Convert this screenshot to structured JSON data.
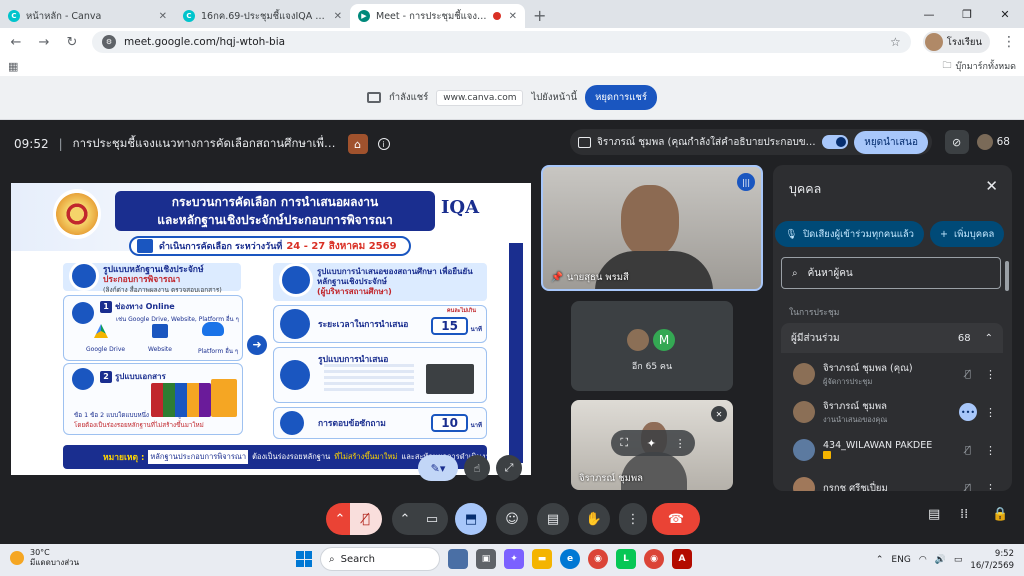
{
  "browser": {
    "tabs": [
      {
        "title": "หน้าหลัก - Canva",
        "active": false,
        "favicon_color": "#00c4cc"
      },
      {
        "title": "16กค.69-ประชุมชี้แจงIQA - พร...",
        "active": false,
        "favicon_color": "#00c4cc"
      },
      {
        "title": "Meet - การประชุมชี้แจงแนวทา...",
        "active": true,
        "favicon_color": "#00897b"
      }
    ],
    "url": "meet.google.com/hqj-wtoh-bia",
    "profile_name": "โรงเรียน",
    "all_bookmarks": "บุ๊กมาร์กทั้งหมด"
  },
  "share_bar": {
    "sharing_label": "กำลังแชร์",
    "shared_site": "www.canva.com",
    "to_label": "ไปยังหน้านี้",
    "stop_label": "หยุดการแชร์"
  },
  "meet": {
    "time": "09:52",
    "meeting_title": "การประชุมชี้แจงแนวทางการคัดเลือกสถานศึกษาเพื่อรับรางวัล...",
    "presenter_text": "จิราภรณ์ ชุมพล (คุณกำลังใส่คำอธิบายประกอบขณะนำเสนอ)",
    "stop_presenting": "หยุดนำเสนอ",
    "participant_count": "68"
  },
  "slide": {
    "title_line1": "กระบวนการคัดเลือก การนำเสนอผลงาน",
    "title_line2": "และหลักฐานเชิงประจักษ์ประกอบการพิจารณา",
    "iqa": "IQA",
    "date_prefix": "ดำเนินการคัดเลือก ระหว่างวันที่",
    "date_range": "24 - 27 สิงหาคม 2569",
    "left_header_1": "รูปแบบหลักฐานเชิงประจักษ์",
    "left_header_2": "ประกอบการพิจารณา",
    "left_header_3": "(ลิงก์ต่าง สื่อภาพผลงาน ตรวจสอบเอกสาร)",
    "item1_title": "ช่องทาง Online",
    "item1_sub": "เช่น Google Drive, Website, Platform อื่น ๆ",
    "item1_icons": [
      "Google Drive",
      "Website",
      "Platform อื่น ๆ"
    ],
    "item2_title": "รูปแบบเอกสาร",
    "item2_note": "ข้อ 1 ข้อ 2 แบบใดแบบหนึ่ง หรือทั้ง 2 รูปแบบ",
    "item2_note2": "โดยต้องเป็นร่องรอยหลักฐานที่ไม่สร้างขึ้นมาใหม่",
    "right_header_1": "รูปแบบการนำเสนอของสถานศึกษา",
    "right_header_2": "เพื่อยืนยันหลักฐานเชิงประจักษ์",
    "right_header_3": "(ผู้บริหารสถานศึกษา)",
    "row1_label": "ระยะเวลาในการนำเสนอ",
    "row1_value": "15",
    "row1_prefix": "คนละไม่เกิน",
    "row1_unit": "นาที",
    "row2_label": "รูปแบบการนำเสนอ",
    "row3_label": "การตอบข้อซักถาม",
    "row3_value": "10",
    "row3_unit": "นาที",
    "note_label": "หมายเหตุ :",
    "note_highlight": "หลักฐานประกอบการพิจารณา",
    "note_text_1": "ต้องเป็นร่องรอยหลักฐาน",
    "note_text_2": "ที่ไม่สร้างขึ้นมาใหม่",
    "note_text_3": "และสะท้อนผลการดำเนินงานจริงของสถานศึกษา"
  },
  "tiles": {
    "speaker_name": "นายสุธน พรมสี",
    "others_count": "อีก 65 คน",
    "others_avatar_letter": "M",
    "self_name": "จิราภรณ์ ชุมพล"
  },
  "people_panel": {
    "title": "บุคคล",
    "mute_all": "ปิดเสียงผู้เข้าร่วมทุกคนแล้ว",
    "add_people": "เพิ่มบุคคล",
    "search_placeholder": "ค้นหาผู้คน",
    "section": "ในการประชุม",
    "group_label": "ผู้มีส่วนร่วม",
    "group_count": "68",
    "participants": [
      {
        "name": "จิราภรณ์ ชุมพล (คุณ)",
        "role": "ผู้จัดการประชุม",
        "action": "mic-off"
      },
      {
        "name": "จิราภรณ์ ชุมพล",
        "role": "งานนำเสนอของคุณ",
        "action": "more-blue"
      },
      {
        "name": "434_WILAWAN PAKDEE",
        "role": "",
        "action": "mic-off"
      },
      {
        "name": "กรกช ศรีชูเปี่ยม",
        "role": "",
        "action": "mic-off"
      }
    ]
  },
  "taskbar": {
    "temperature": "30°C",
    "weather": "มีแดดบางส่วน",
    "search": "Search",
    "lang": "ENG",
    "time": "9:52",
    "date": "16/7/2569"
  },
  "colors": {
    "meet_bg": "#202124",
    "accent": "#a8c7fa",
    "end_call": "#ea4335",
    "slide_navy": "#1a2e8f"
  }
}
